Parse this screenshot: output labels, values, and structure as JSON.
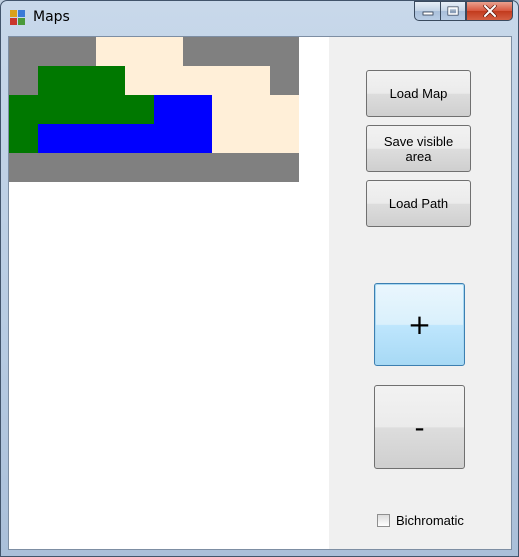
{
  "window": {
    "title": "Maps",
    "icon": "app-window-icon",
    "controls": {
      "minimize_icon": "minimize-icon",
      "maximize_icon": "maximize-icon",
      "close_icon": "close-icon"
    }
  },
  "colors": {
    "gray": "#808080",
    "sand": "#ffefd8",
    "green": "#007800",
    "blue": "#0000ff",
    "white": "#ffffff"
  },
  "map": {
    "columns": 10,
    "rows": 5,
    "grid": [
      [
        "gray",
        "gray",
        "gray",
        "sand",
        "sand",
        "sand",
        "gray",
        "gray",
        "gray",
        "gray"
      ],
      [
        "gray",
        "green",
        "green",
        "green",
        "sand",
        "sand",
        "sand",
        "sand",
        "sand",
        "gray"
      ],
      [
        "green",
        "green",
        "green",
        "green",
        "green",
        "blue",
        "blue",
        "sand",
        "sand",
        "sand"
      ],
      [
        "green",
        "blue",
        "blue",
        "blue",
        "blue",
        "blue",
        "blue",
        "sand",
        "sand",
        "sand"
      ],
      [
        "gray",
        "gray",
        "gray",
        "gray",
        "gray",
        "gray",
        "gray",
        "gray",
        "gray",
        "gray"
      ]
    ]
  },
  "buttons": {
    "load_map": "Load Map",
    "save_visible": "Save visible area",
    "load_path": "Load Path",
    "zoom_in": "+",
    "zoom_out": "-"
  },
  "options": {
    "bichromatic_label": "Bichromatic",
    "bichromatic_checked": false
  }
}
